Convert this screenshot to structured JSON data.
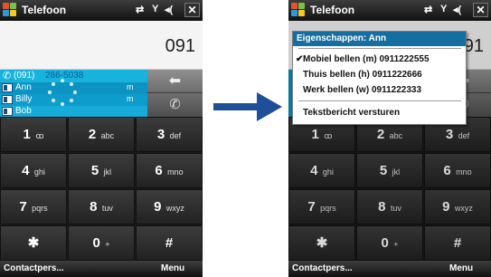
{
  "title": "Telefoon",
  "status_icons": {
    "sync": "⇄",
    "signal": "Y",
    "volume": "◂(",
    "close": "✕"
  },
  "left": {
    "number": "091",
    "suggestions": {
      "top_number_main": "(091)",
      "top_number_rest": "286-5038",
      "contacts": [
        {
          "name": "Ann",
          "tag": "m"
        },
        {
          "name": "Billy",
          "tag": "m"
        },
        {
          "name": "Bob",
          "tag": ""
        }
      ]
    },
    "back_glyph": "⬅",
    "talk_glyph": "✆"
  },
  "right": {
    "number": "091",
    "menu": {
      "header": "Eigenschappen: Ann",
      "items": [
        {
          "label": "Mobiel bellen (m) 0911222555",
          "checked": "✔"
        },
        {
          "label": "Thuis bellen (h) 0911222666",
          "checked": ""
        },
        {
          "label": "Werk bellen (w) 0911222333",
          "checked": ""
        },
        {
          "label": "Tekstbericht versturen",
          "checked": ""
        }
      ]
    }
  },
  "keypad": [
    {
      "digit": "1",
      "letters": "ꝏ"
    },
    {
      "digit": "2",
      "letters": "abc"
    },
    {
      "digit": "3",
      "letters": "def"
    },
    {
      "digit": "4",
      "letters": "ghi"
    },
    {
      "digit": "5",
      "letters": "jkl"
    },
    {
      "digit": "6",
      "letters": "mno"
    },
    {
      "digit": "7",
      "letters": "pqrs"
    },
    {
      "digit": "8",
      "letters": "tuv"
    },
    {
      "digit": "9",
      "letters": "wxyz"
    },
    {
      "digit": "✱",
      "letters": ""
    },
    {
      "digit": "0",
      "letters": "+"
    },
    {
      "digit": "#",
      "letters": ""
    }
  ],
  "softkeys": {
    "left": "Contactpers...",
    "right": "Menu"
  },
  "colors": {
    "selection_blue": "#0b9ecc",
    "menu_header": "#156ea0",
    "arrow": "#1f4f99"
  }
}
